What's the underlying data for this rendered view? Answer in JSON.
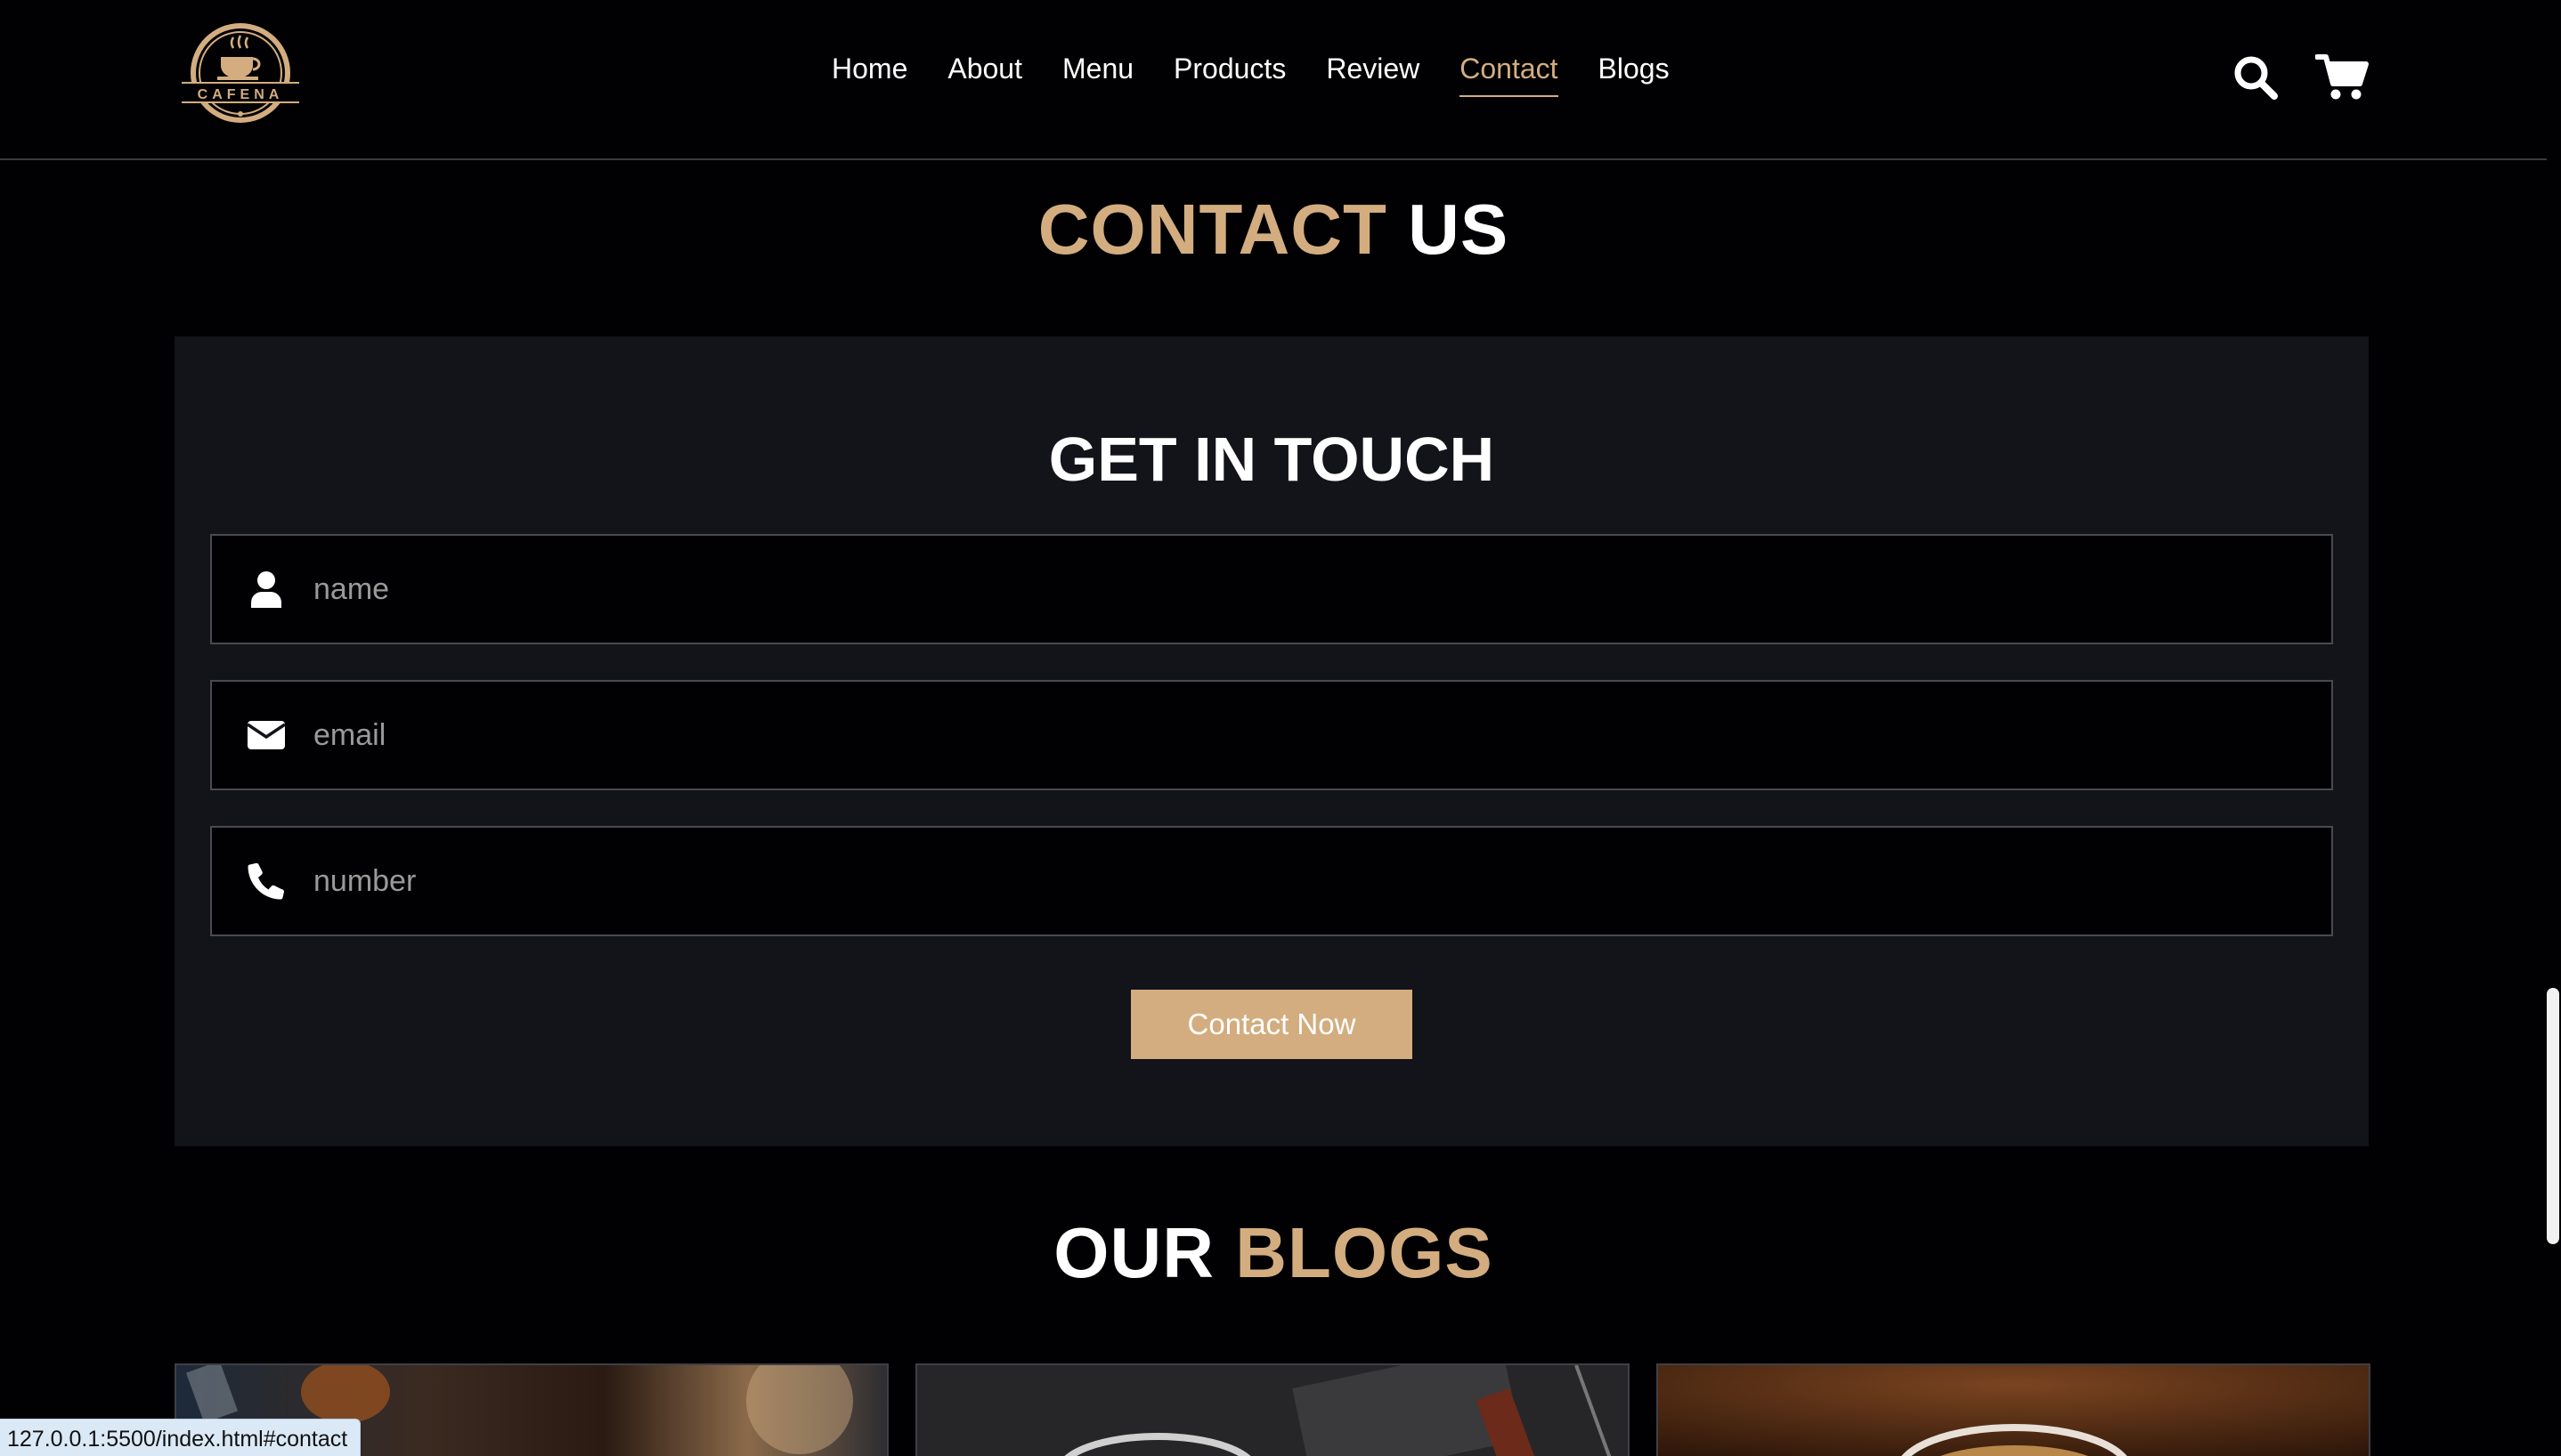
{
  "header": {
    "logo_text": "CAFENA",
    "nav": [
      {
        "label": "Home"
      },
      {
        "label": "About"
      },
      {
        "label": "Menu"
      },
      {
        "label": "Products"
      },
      {
        "label": "Review"
      },
      {
        "label": "Contact",
        "active": true
      },
      {
        "label": "Blogs"
      }
    ],
    "icons": [
      "search-icon",
      "cart-icon"
    ]
  },
  "contact_section": {
    "title_part1": "CONTACT",
    "title_part2": " US"
  },
  "form": {
    "title": "GET IN TOUCH",
    "name_placeholder": "name",
    "email_placeholder": "email",
    "number_placeholder": "number",
    "submit_label": "Contact Now",
    "icons": [
      "user-icon",
      "envelope-icon",
      "phone-icon"
    ]
  },
  "blogs_section": {
    "title_part1": "OUR ",
    "title_part2": "BLOGS"
  },
  "status_bar": {
    "url": "127.0.0.1:5500/index.html#contact"
  },
  "colors": {
    "accent": "#d3ad7f",
    "background": "#010103",
    "panel": "#13131a"
  }
}
